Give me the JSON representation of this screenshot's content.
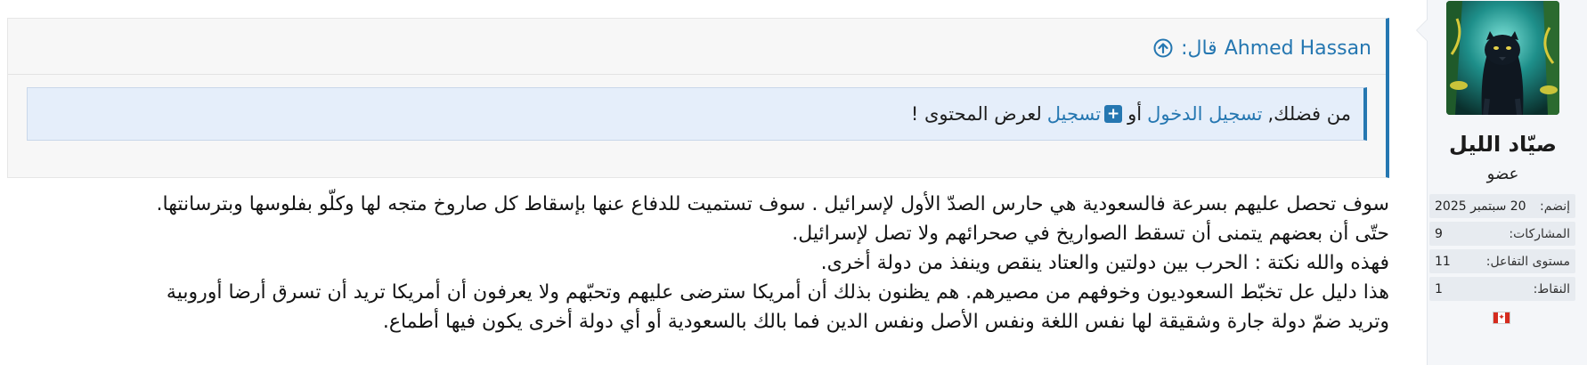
{
  "quote": {
    "author": "Ahmed Hassan",
    "said": "قال:",
    "notice_prefix": "من فضلك,",
    "login_link": "تسجيل الدخول",
    "or_word": "أو",
    "register_link": "تسجيل",
    "notice_suffix": "لعرض المحتوى !"
  },
  "post": {
    "lines": [
      "سوف تحصل عليهم بسرعة فالسعودية هي حارس الصدّ الأول لإسرائيل . سوف تستميت للدفاع عنها بإسقاط كل صاروخ متجه لها وكلّو بفلوسها وبترسانتها.",
      "حتّى أن بعضهم يتمنى أن تسقط الصواريخ في صحرائهم ولا تصل لإسرائيل.",
      "فهذه والله نكتة : الحرب بين دولتين والعتاد ينقص وينفذ من دولة أخرى.",
      "هذا دليل عل تخبّط السعوديون وخوفهم من مصيرهم. هم يظنون بذلك أن أمريكا سترضى عليهم وتحبّهم ولا يعرفون أن أمريكا تريد أن تسرق أرضا أوروبية",
      "وتريد ضمّ دولة جارة وشقيقة لها نفس اللغة ونفس الأصل ونفس الدين فما بالك بالسعودية أو أي دولة أخرى يكون فيها أطماع."
    ]
  },
  "user": {
    "name": "صيّاد الليل",
    "title": "عضو",
    "stats": [
      {
        "label": "إنضم:",
        "value": "20 سبتمبر 2025"
      },
      {
        "label": "المشاركات:",
        "value": "9"
      },
      {
        "label": "مستوى التفاعل:",
        "value": "11"
      },
      {
        "label": "النقاط:",
        "value": "1"
      }
    ],
    "flag": "canada-flag-icon"
  },
  "colors": {
    "link": "#2577b1",
    "quote_bg": "#f7f7f7",
    "notice_bg": "#e5eefa",
    "sidebar_bg": "#f4f6f9"
  }
}
